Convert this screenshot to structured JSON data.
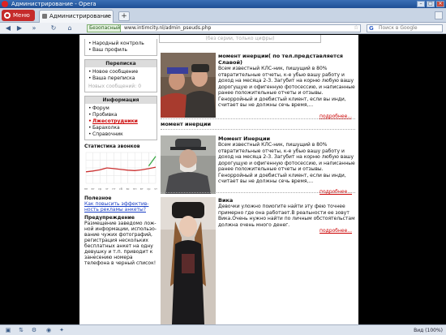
{
  "window": {
    "title": "Администрирование - Opera"
  },
  "tabbar": {
    "menu_label": "Меню",
    "tab_label": "Администрирование",
    "new_tab": "+"
  },
  "addressbar": {
    "secure_label": "Безопасный",
    "url": "www.intimcity.nl/admin_pseuds.php",
    "search_placeholder": "Поиск в Google",
    "search_engine": "G"
  },
  "page": {
    "search_hint": "(без серии, только цифры)",
    "sidebar": {
      "top_links": [
        "Народный контроль",
        "Ваш профиль"
      ],
      "messages": {
        "title": "Переписка",
        "items": [
          "Новое сообщение",
          "Ваша переписка"
        ],
        "muted": "Новых сообщений: 0"
      },
      "info": {
        "title": "Информация",
        "items": [
          "Форум",
          "Пробивка",
          "Лжесотрудники",
          "Барахолка",
          "Справочник"
        ],
        "active": "Лжесотрудники"
      },
      "stats_title": "Статистика звонков",
      "stats_axis": [
        "пн",
        "вт",
        "ср",
        "чт",
        "пт",
        "сб",
        "вс",
        "пн",
        "вт",
        "ср",
        "чт"
      ],
      "useful_title": "Полезное",
      "useful_link": "Как повысить эффектив-ность рекламы анкеты?",
      "warning_title": "Предупреждение",
      "warning_text": "Размещение заведомо лож-ной информации, использо-вание чужих фотографий, регистрация нескольких бесплатных анкет на одну девушку и т.п. приводит к занесению номера телефона в черный список!"
    },
    "entries": [
      {
        "title": "момент инерции( по тел.представляется Славой)",
        "body": "Всем известный КЛС-ник, пишущий в 80% отвратительные отчеты, к-е убью вашу работу и доход на месяца 2-3. Загубит на корню любую вашу дорогущую и офигенную фотосессию, и написанные ранее положительные отчеты и отзывы. Генорройный и доебистый клиент, если вы инди, считает вы не должны сечь время,...",
        "more": "подробнее..."
      },
      {
        "title": "момент инерции"
      },
      {
        "title": "Момент Инерции",
        "body": "Всем известный КЛС-ник, пишущий в 80% отвратительные отчеты, к-е убью вашу работу и доход на месяца 2-3. Загубит на корню любую вашу дорогущую и офигенную фотосессию, и написанные ранее положительные отчеты и отзывы. Генорройный и доебистый клиент, если вы инди, считает вы не должны сечь время,...",
        "more": "подробнее..."
      },
      {
        "title": "Вика",
        "body": "Девочки уложно поиогите найти эту фею точнее примерно где она работает.В реальности ее зовут Вика.Очень нужно найти по личным обстоятельстам должна очень много денег.",
        "more": "подробнее..."
      }
    ]
  },
  "statusbar": {
    "zoom": "Вид (100%)"
  },
  "chart_data": {
    "type": "line",
    "title": "Статистика звонков",
    "series": [
      {
        "color": "#cc3333",
        "values": [
          30,
          32,
          35,
          40,
          38,
          36,
          34,
          33,
          35,
          38,
          42
        ]
      },
      {
        "color": "#3aa845",
        "values": [
          null,
          null,
          null,
          null,
          null,
          null,
          null,
          null,
          null,
          45,
          70
        ]
      }
    ],
    "categories": [
      "пн",
      "вт",
      "ср",
      "чт",
      "пт",
      "сб",
      "вс",
      "пн",
      "вт",
      "ср",
      "чт"
    ],
    "ylim": [
      0,
      80
    ],
    "grid": true
  }
}
